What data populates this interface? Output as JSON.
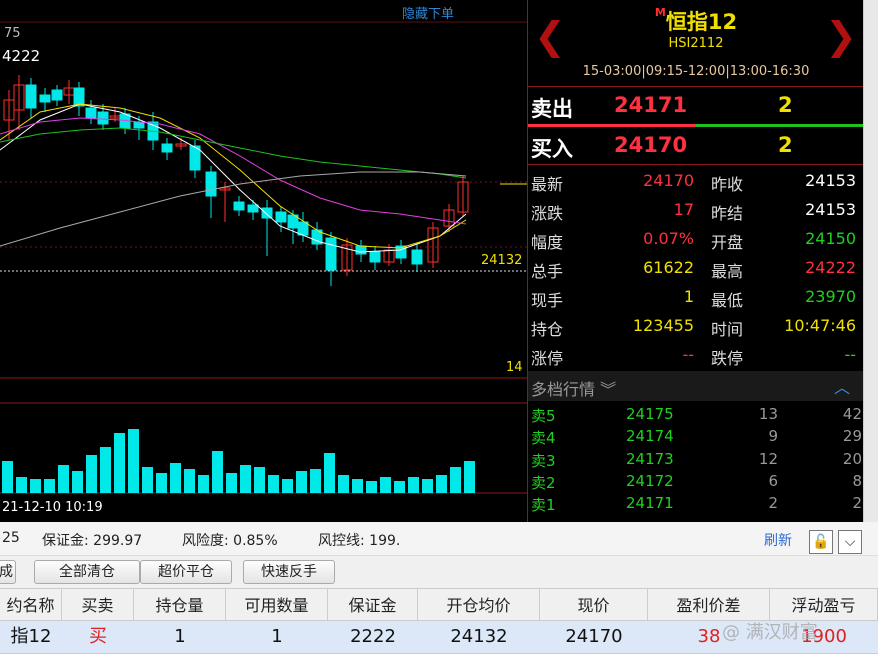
{
  "chart": {
    "hide_orders_label": "隐藏下单",
    "top_value_label": "75",
    "high_label": "4222",
    "price_label": "24132",
    "macd_label": "14",
    "date_label": "21-12-10 10:19",
    "colors": {
      "up": "#ff3030",
      "down": "#00e8e8",
      "ma5": "#ffffff",
      "ma10": "#f0e000",
      "ma20": "#e040e0",
      "ma60": "#20c020",
      "volume": "#00e8e8"
    }
  },
  "quote": {
    "name_prefix": "M",
    "name": "恒指12",
    "code": "HSI2112",
    "hours": "15-03:00|09:15-12:00|13:00-16:30",
    "prev_arrow": "❮",
    "next_arrow": "❯",
    "sell": {
      "label": "卖出",
      "price": "24171",
      "volume": "2"
    },
    "buy": {
      "label": "买入",
      "price": "24170",
      "volume": "2"
    },
    "rows": [
      {
        "k1": "最新",
        "v1": "24170",
        "k2": "昨收",
        "v2": "24153"
      },
      {
        "k1": "涨跌",
        "v1": "17",
        "k2": "昨结",
        "v2": "24153"
      },
      {
        "k1": "幅度",
        "v1": "0.07%",
        "k2": "开盘",
        "v2": "24150"
      },
      {
        "k1": "总手",
        "v1": "61622",
        "k2": "最高",
        "v2": "24222"
      },
      {
        "k1": "现手",
        "v1": "1",
        "k2": "最低",
        "v2": "23970"
      },
      {
        "k1": "持仓",
        "v1": "123455",
        "k2": "时间",
        "v2": "10:47:46"
      },
      {
        "k1": "涨停",
        "v1": "--",
        "k2": "跌停",
        "v2": "--"
      }
    ],
    "depth_title": "多档行情",
    "depth_toggle": "︾",
    "depth_collapse": "︿",
    "depth": [
      {
        "label": "卖5",
        "price": "24175",
        "vol": "13",
        "vol2": "42"
      },
      {
        "label": "卖4",
        "price": "24174",
        "vol": "9",
        "vol2": "29"
      },
      {
        "label": "卖3",
        "price": "24173",
        "vol": "12",
        "vol2": "20"
      },
      {
        "label": "卖2",
        "price": "24172",
        "vol": "6",
        "vol2": "8"
      },
      {
        "label": "卖1",
        "price": "24171",
        "vol": "2",
        "vol2": "2"
      }
    ]
  },
  "account": {
    "left_value": "25",
    "margin": "保证金: 299.97",
    "risk": "风险度: 0.85%",
    "risk_line": "风控线: 199.",
    "refresh": "刷新",
    "lock_icon": "🔓",
    "dropdown_icon": "⌵"
  },
  "buttons": {
    "partial": "成",
    "close_all": "全部清仓",
    "close_over": "超价平仓",
    "reverse": "快速反手"
  },
  "table": {
    "headers": [
      "约名称",
      "买卖",
      "持仓量",
      "可用数量",
      "保证金",
      "开仓均价",
      "现价",
      "盈利价差",
      "浮动盈亏"
    ],
    "row": [
      "指12",
      "买",
      "1",
      "1",
      "2222",
      "24132",
      "24170",
      "38",
      "1900"
    ]
  },
  "watermark": "@ 满汉财富"
}
